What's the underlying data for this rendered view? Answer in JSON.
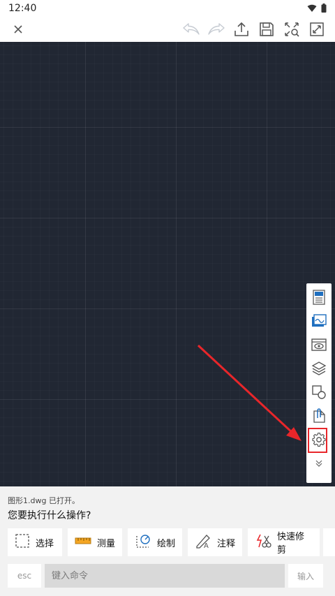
{
  "status": {
    "time": "12:40"
  },
  "toolbar": {
    "buttons": [
      "close-icon",
      "undo-icon",
      "redo-icon",
      "share-icon",
      "save-icon",
      "zoom-extents-icon",
      "fullscreen-icon"
    ]
  },
  "side_panel": {
    "items": [
      "properties-icon",
      "layouts-icon",
      "view-icon",
      "layers-icon",
      "blocks-icon",
      "attach-icon",
      "settings-icon",
      "collapse-icon"
    ],
    "highlighted": "settings-icon",
    "highlight_color": "#e8262a"
  },
  "messages": {
    "line1": "图形1.dwg 已打开。",
    "line2": "您要执行什么操作?"
  },
  "actions": [
    {
      "label": "选择",
      "icon": "select-icon"
    },
    {
      "label": "测量",
      "icon": "ruler-icon"
    },
    {
      "label": "绘制",
      "icon": "draw-icon"
    },
    {
      "label": "注释",
      "icon": "annotate-icon"
    },
    {
      "label": "快速修剪",
      "icon": "quick-trim-icon"
    }
  ],
  "command": {
    "esc_label": "esc",
    "placeholder": "键入命令",
    "enter_label": "输入"
  },
  "colors": {
    "canvas": "#212733",
    "accent": "#1f6fbf",
    "annotation_red": "#e8262a"
  }
}
